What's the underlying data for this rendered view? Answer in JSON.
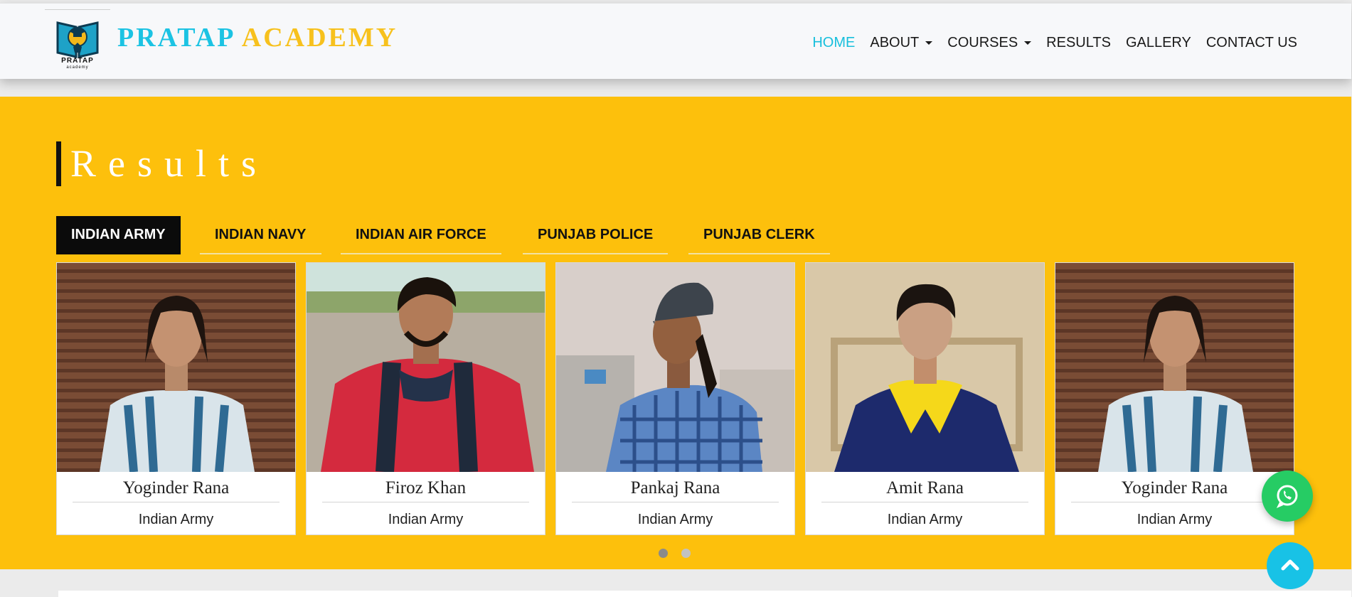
{
  "brand": {
    "word1": "PRATAP",
    "word2": "ACADEMY",
    "logo_text": "PRATAP",
    "logo_sub": "academy",
    "logo_icon": "book-graduate-icon"
  },
  "nav": [
    {
      "label": "HOME",
      "active": true,
      "dropdown": false
    },
    {
      "label": "ABOUT",
      "active": false,
      "dropdown": true
    },
    {
      "label": "COURSES",
      "active": false,
      "dropdown": true
    },
    {
      "label": "RESULTS",
      "active": false,
      "dropdown": false
    },
    {
      "label": "GALLERY",
      "active": false,
      "dropdown": false
    },
    {
      "label": "CONTACT US",
      "active": false,
      "dropdown": false
    }
  ],
  "results": {
    "title": "Results",
    "tabs": [
      "INDIAN ARMY",
      "INDIAN NAVY",
      "INDIAN AIR FORCE",
      "PUNJAB POLICE",
      "PUNJAB CLERK"
    ],
    "active_tab": "INDIAN ARMY",
    "cards": [
      {
        "name": "Yoginder Rana",
        "role": "Indian Army"
      },
      {
        "name": "Firoz Khan",
        "role": "Indian Army"
      },
      {
        "name": "Pankaj Rana",
        "role": "Indian Army"
      },
      {
        "name": "Amit Rana",
        "role": "Indian Army"
      },
      {
        "name": "Yoginder Rana",
        "role": "Indian Army"
      }
    ],
    "carousel": {
      "pages": 2,
      "current": 1
    }
  },
  "colors": {
    "accent_cyan": "#1cc3e3",
    "accent_yellow": "#f7c11d",
    "section_bg": "#fdc00c",
    "whatsapp": "#26cc64"
  },
  "fab": {
    "whatsapp_icon": "whatsapp-icon",
    "scroll_top_icon": "chevron-up-icon"
  }
}
